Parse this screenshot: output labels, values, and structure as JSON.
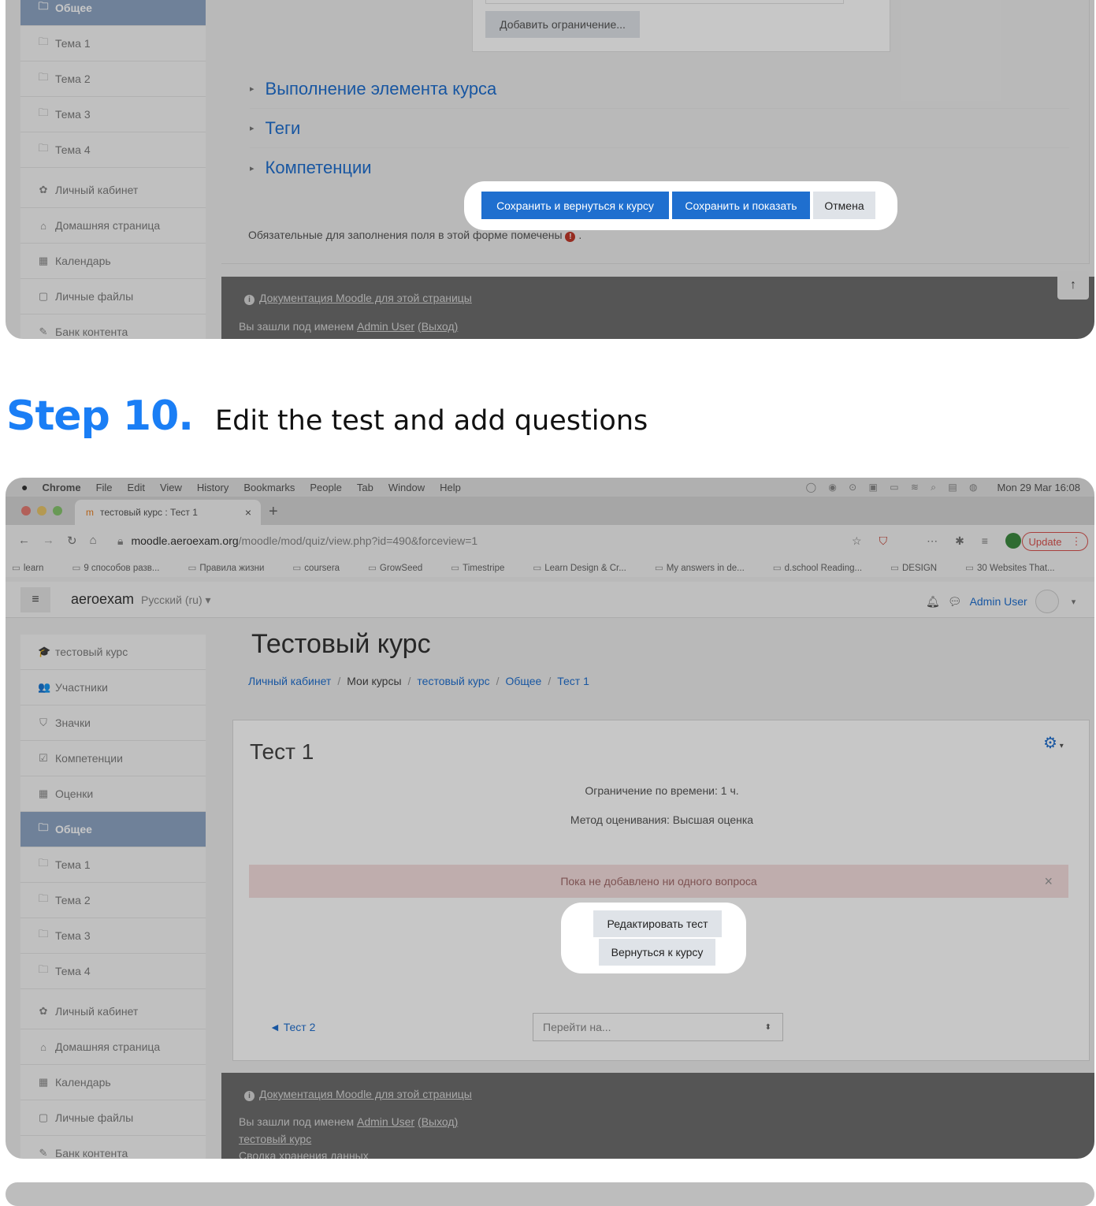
{
  "top_shot": {
    "sidebar": [
      {
        "icon": "folder-icon",
        "glyph": "🗀",
        "label": "Общее",
        "active": true
      },
      {
        "icon": "folder-icon",
        "glyph": "🗀",
        "label": "Тема 1"
      },
      {
        "icon": "folder-icon",
        "glyph": "🗀",
        "label": "Тема 2"
      },
      {
        "icon": "folder-icon",
        "glyph": "🗀",
        "label": "Тема 3"
      },
      {
        "icon": "folder-icon",
        "glyph": "🗀",
        "label": "Тема 4"
      },
      {
        "icon": "dashboard-icon",
        "glyph": "✿",
        "label": "Личный кабинет",
        "gap": true
      },
      {
        "icon": "home-icon",
        "glyph": "⌂",
        "label": "Домашняя страница"
      },
      {
        "icon": "calendar-icon",
        "glyph": "▦",
        "label": "Календарь"
      },
      {
        "icon": "file-icon",
        "glyph": "▢",
        "label": "Личные файлы"
      },
      {
        "icon": "brush-icon",
        "glyph": "✎",
        "label": "Банк контента"
      }
    ],
    "add_restriction": "Добавить ограничение...",
    "sections": [
      "Выполнение элемента курса",
      "Теги",
      "Компетенции"
    ],
    "buttons": {
      "save_return": "Сохранить и вернуться к курсу",
      "save_show": "Сохранить и показать",
      "cancel": "Отмена"
    },
    "required_note": "Обязательные для заполнения поля в этой форме помечены",
    "required_dot": ".",
    "footer": {
      "docs_link": "Документация Moodle для этой страницы",
      "logged_prefix": "Вы зашли под именем",
      "user": "Admin User",
      "logout": "(Выход)"
    }
  },
  "step": {
    "number": "Step 10.",
    "title": "Edit the test and add questions"
  },
  "browser": {
    "menubar": [
      "Chrome",
      "File",
      "Edit",
      "View",
      "History",
      "Bookmarks",
      "People",
      "Tab",
      "Window",
      "Help"
    ],
    "clock": "Mon 29 Mar  16:08",
    "tab_title": "тестовый курс : Тест 1",
    "url_domain": "moodle.aeroexam.org",
    "url_path": "/moodle/mod/quiz/view.php?id=490&forceview=1",
    "update_label": "Update",
    "bookmarks": [
      "learn",
      "9 способов разв...",
      "Правила жизни",
      "coursera",
      "GrowSeed",
      "Timestripe",
      "Learn Design & Cr...",
      "My answers in de...",
      "d.school Reading...",
      "DESIGN",
      "30 Websites That..."
    ]
  },
  "moodle": {
    "site_name": "aeroexam",
    "language": "Русский (ru)",
    "user_name": "Admin User",
    "course_title": "Тестовый курс",
    "breadcrumb": [
      "Личный кабинет",
      "Мои курсы",
      "тестовый курс",
      "Общее",
      "Тест 1"
    ],
    "sidebar": [
      {
        "icon": "graduation-cap-icon",
        "glyph": "🎓",
        "label": "тестовый курс"
      },
      {
        "icon": "users-icon",
        "glyph": "👥",
        "label": "Участники"
      },
      {
        "icon": "shield-icon",
        "glyph": "⛉",
        "label": "Значки"
      },
      {
        "icon": "checkbox-icon",
        "glyph": "☑",
        "label": "Компетенции"
      },
      {
        "icon": "table-icon",
        "glyph": "▦",
        "label": "Оценки"
      },
      {
        "icon": "folder-icon",
        "glyph": "🗀",
        "label": "Общее",
        "active": true
      },
      {
        "icon": "folder-icon",
        "glyph": "🗀",
        "label": "Тема 1"
      },
      {
        "icon": "folder-icon",
        "glyph": "🗀",
        "label": "Тема 2"
      },
      {
        "icon": "folder-icon",
        "glyph": "🗀",
        "label": "Тема 3"
      },
      {
        "icon": "folder-icon",
        "glyph": "🗀",
        "label": "Тема 4"
      },
      {
        "icon": "dashboard-icon",
        "glyph": "✿",
        "label": "Личный кабинет",
        "gap": true
      },
      {
        "icon": "home-icon",
        "glyph": "⌂",
        "label": "Домашняя страница"
      },
      {
        "icon": "calendar-icon",
        "glyph": "▦",
        "label": "Календарь"
      },
      {
        "icon": "file-icon",
        "glyph": "▢",
        "label": "Личные файлы"
      },
      {
        "icon": "brush-icon",
        "glyph": "✎",
        "label": "Банк контента"
      }
    ],
    "quiz_title": "Тест 1",
    "time_limit": "Ограничение по времени: 1 ч.",
    "grading_method": "Метод оценивания: Высшая оценка",
    "no_questions_alert": "Пока не добавлено ни одного вопроса",
    "edit_button": "Редактировать тест",
    "return_button": "Вернуться к курсу",
    "prev_link": "◄ Тест 2",
    "jump_placeholder": "Перейти на...",
    "footer": {
      "docs_link": "Документация Moodle для этой страницы",
      "logged_prefix": "Вы зашли под именем",
      "user": "Admin User",
      "logout": "(Выход)",
      "course_link": "тестовый курс",
      "data_retention": "Сводка хранения данных"
    }
  },
  "colors": {
    "accent_blue": "#1a7ef5",
    "moodle_button": "#1f6fcf",
    "active_sidebar": "#8fa6c4",
    "alert_bg": "#f5dede"
  }
}
